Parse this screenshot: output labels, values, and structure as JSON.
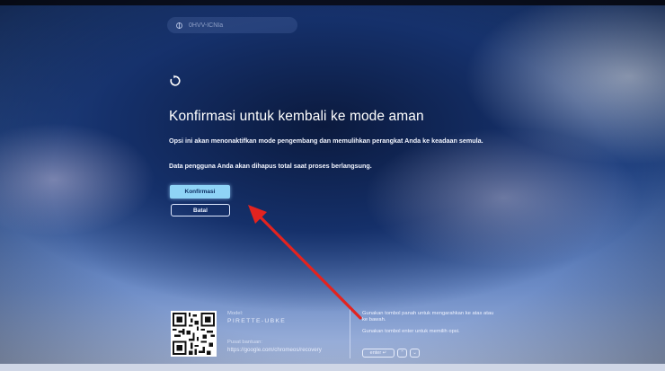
{
  "network": {
    "label": "0HVV-ICNIa",
    "icon": "globe-icon"
  },
  "header": {
    "icon": "refresh-icon"
  },
  "dialog": {
    "title": "Konfirmasi untuk kembali ke mode aman",
    "description": "Opsi ini akan menonaktifkan mode pengembang dan memulihkan perangkat Anda ke keadaan semula.",
    "warning": "Data pengguna Anda akan dihapus total saat proses berlangsung.",
    "confirm_label": "Konfirmasi",
    "cancel_label": "Batal"
  },
  "footer": {
    "model_label": "Model:",
    "model_value": "PIRETTE-UBKE",
    "help_label": "Pusat bantuan:",
    "help_url": "https://google.com/chromeos/recovery",
    "hint_navigate": "Gunakan tombol panah untuk mengarahkan ke atas atau ke bawah.",
    "hint_select": "Gunakan tombol enter untuk memilih opsi.",
    "key_enter": "enter ↵",
    "key_up": "⌃",
    "key_down": "⌄"
  },
  "colors": {
    "confirm_button": "#8fd4f6",
    "annotation_arrow": "#e3231f",
    "background_dark": "#0b1a3e",
    "background_light": "#aebfe2"
  }
}
